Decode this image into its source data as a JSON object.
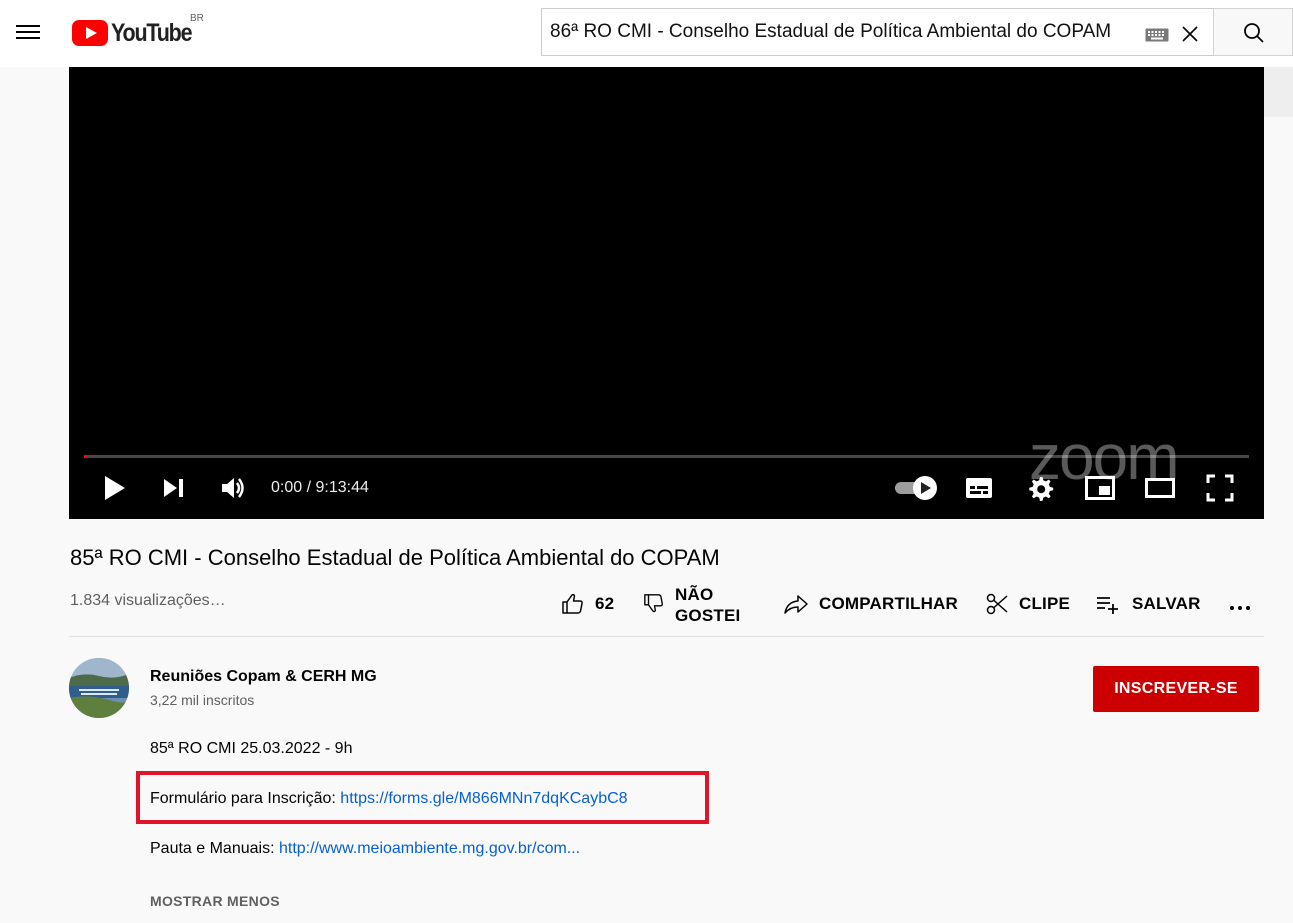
{
  "masthead": {
    "logo_text": "YouTube",
    "country_code": "BR",
    "search_value": "86ª RO CMI - Conselho Estadual de Política Ambiental do COPAM"
  },
  "player": {
    "watermark": "zoom",
    "time_current": "0:00",
    "time_separator": " / ",
    "time_total": "9:13:44",
    "progress_fraction": 0.0
  },
  "video": {
    "title": "85ª RO CMI - Conselho Estadual de Política Ambiental do COPAM",
    "views": "1.834 visualizações…",
    "actions": {
      "like_count": "62",
      "dislike_label_1": "NÃO",
      "dislike_label_2": "GOSTEI",
      "share_label": "COMPARTILHAR",
      "clip_label": "CLIPE",
      "save_label": "SALVAR"
    }
  },
  "channel": {
    "name": "Reuniões Copam & CERH MG",
    "subscribers": "3,22 mil inscritos",
    "subscribe_label": "INSCREVER-SE"
  },
  "description": {
    "line1": "85ª RO CMI 25.03.2022 - 9h",
    "form_label": "Formulário para Inscrição: ",
    "form_link": "https://forms.gle/M866MNn7dqKCaybC8",
    "agenda_label": "Pauta e Manuais: ",
    "agenda_link": "http://www.meioambiente.mg.gov.br/com...",
    "show_less": "MOSTRAR MENOS"
  },
  "colors": {
    "brand_red": "#ff0000",
    "subscribe_red": "#cc0000",
    "link_blue": "#065fd4",
    "highlight_red": "#e0142b"
  }
}
